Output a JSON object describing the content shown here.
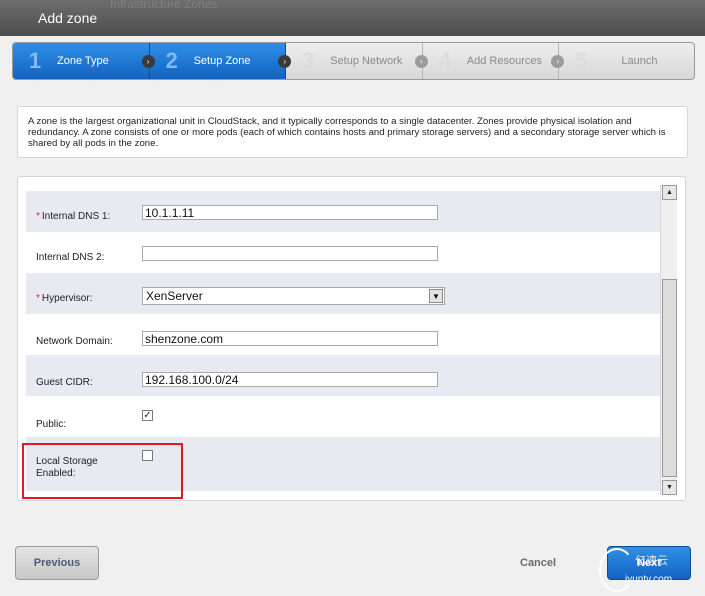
{
  "dialog": {
    "title": "Add zone",
    "background_text": "Infrastructure   Zones"
  },
  "steps": [
    {
      "number": "1",
      "label": "Zone Type",
      "state": "active"
    },
    {
      "number": "2",
      "label": "Setup Zone",
      "state": "active"
    },
    {
      "number": "3",
      "label": "Setup Network",
      "state": "inactive"
    },
    {
      "number": "4",
      "label": "Add Resources",
      "state": "inactive"
    },
    {
      "number": "5",
      "label": "Launch",
      "state": "inactive"
    }
  ],
  "description": "A zone is the largest organizational unit in CloudStack, and it typically corresponds to a single datacenter. Zones provide physical isolation and redundancy. A zone consists of one or more pods (each of which contains hosts and primary storage servers) and a secondary storage server which is shared by all pods in the zone.",
  "form": {
    "internal_dns1": {
      "label": "Internal DNS 1:",
      "required": true,
      "value": "10.1.1.11"
    },
    "internal_dns2": {
      "label": "Internal DNS 2:",
      "required": false,
      "value": ""
    },
    "hypervisor": {
      "label": "Hypervisor:",
      "required": true,
      "value": "XenServer"
    },
    "network_domain": {
      "label": "Network Domain:",
      "required": false,
      "value": "shenzone.com"
    },
    "guest_cidr": {
      "label": "Guest CIDR:",
      "required": false,
      "value": "192.168.100.0/24"
    },
    "public": {
      "label": "Public:",
      "checked": true,
      "check_glyph": "✓"
    },
    "local_storage": {
      "label_line1": "Local Storage",
      "label_line2": "Enabled:",
      "checked": false
    },
    "required_marker": "*"
  },
  "buttons": {
    "previous": "Previous",
    "cancel": "Cancel",
    "next": "Next"
  },
  "watermark": {
    "line1": "亿速云",
    "line2": "iyuntv.com"
  },
  "colors": {
    "accent_blue": "#1a72d6",
    "highlight_red": "#e01a22",
    "required_red": "#d22222"
  }
}
